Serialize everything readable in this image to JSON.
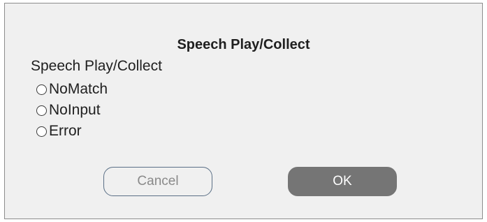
{
  "dialog": {
    "title": "Speech Play/Collect",
    "group_label": "Speech Play/Collect",
    "options": [
      {
        "label": "NoMatch",
        "selected": false
      },
      {
        "label": "NoInput",
        "selected": false
      },
      {
        "label": "Error",
        "selected": false
      }
    ],
    "buttons": {
      "cancel_label": "Cancel",
      "ok_label": "OK"
    }
  }
}
